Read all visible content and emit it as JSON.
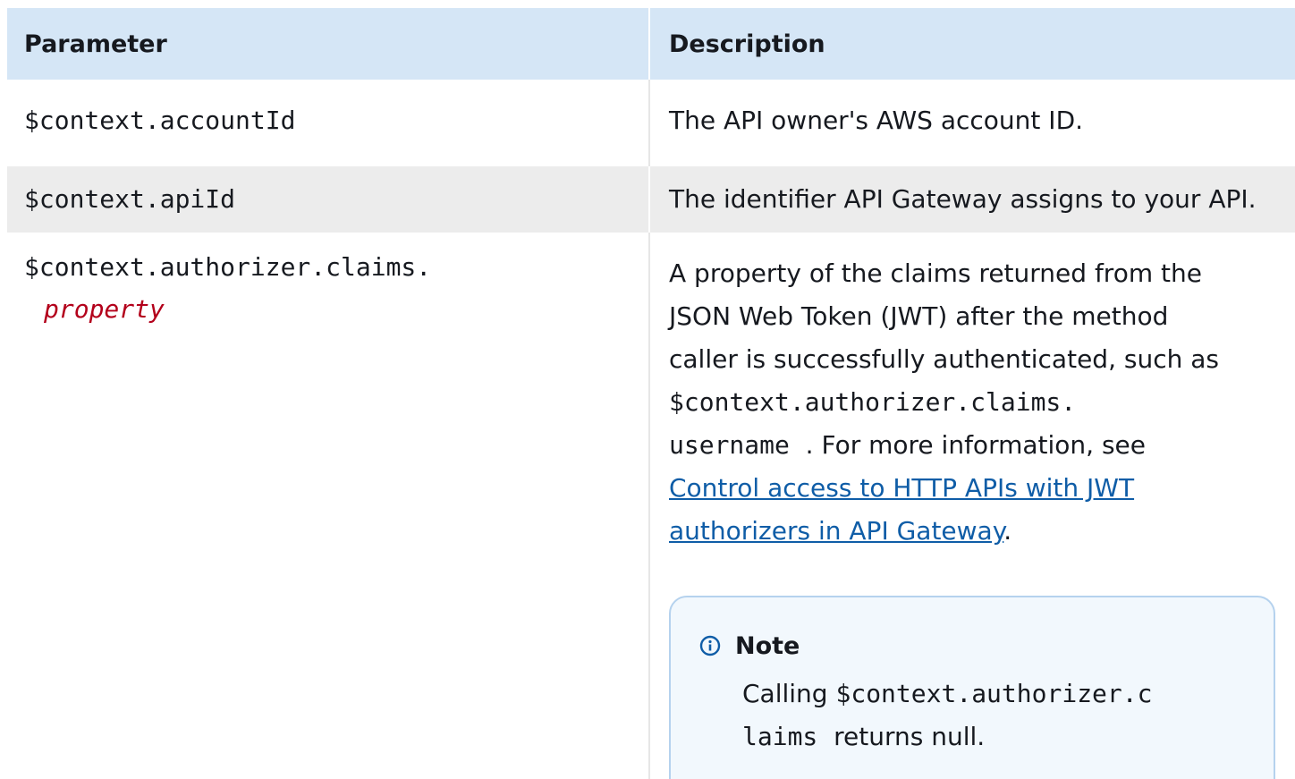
{
  "table": {
    "headers": {
      "parameter": "Parameter",
      "description": "Description"
    },
    "rows": [
      {
        "parameter": "$context.accountId",
        "description": "The API owner's AWS account ID."
      },
      {
        "parameter": "$context.apiId",
        "description": "The identifier API Gateway assigns to your API."
      },
      {
        "parameter": "$context.authorizer.claims.",
        "parameter_placeholder": "property",
        "description_prefix": "A property of the claims returned from the JSON Web Token (JWT) after the method caller is successfully authenticated, such as",
        "description_code_1": "$context.authorizer.claims.",
        "description_code_2": "username",
        "description_middle": ". For more information, see",
        "link_text": "Control access to HTTP APIs with JWT authorizers in API Gateway",
        "description_suffix": ".",
        "note": {
          "icon": "info-icon",
          "title": "Note",
          "body_prefix": "Calling",
          "body_code": "$context.authorizer.claims",
          "body_suffix": "returns null."
        }
      }
    ]
  },
  "colors": {
    "header_bg": "#d5e6f6",
    "stripe_bg": "#ececec",
    "link": "#0f5da7",
    "placeholder": "#b3001b",
    "note_border": "#b5d2ee",
    "note_bg": "#f2f8fd",
    "info_icon": "#0f5da7"
  }
}
